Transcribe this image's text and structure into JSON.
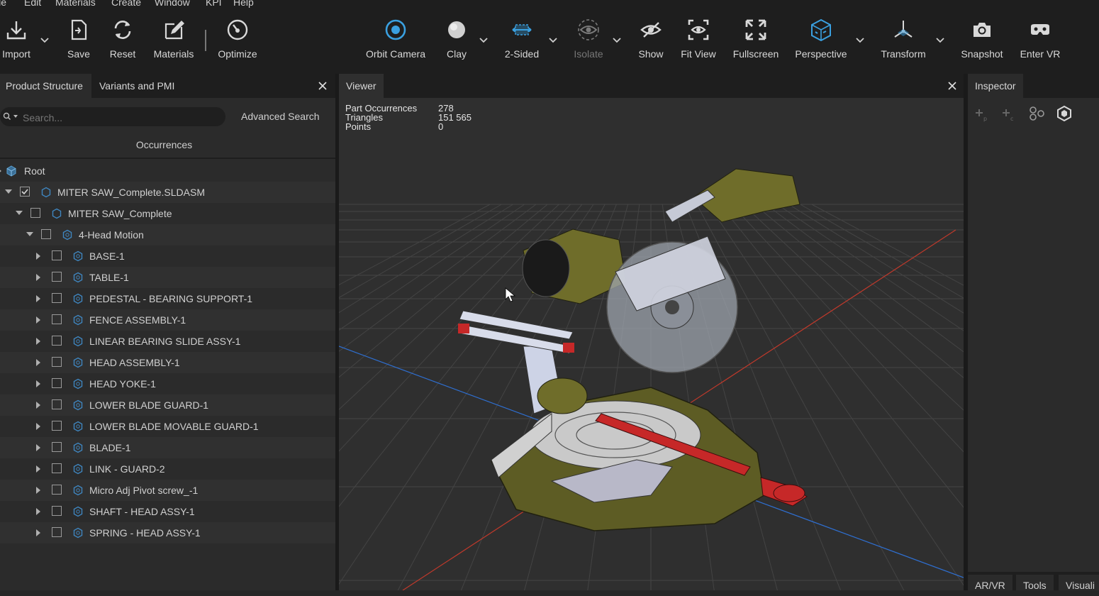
{
  "menu": [
    "ile",
    "Edit",
    "Materials",
    "Create",
    "Window",
    "KPI",
    "Help"
  ],
  "toolbar": {
    "left": [
      {
        "label": "Import",
        "icon": "import-icon"
      },
      {
        "label": "Save",
        "icon": "save-icon"
      },
      {
        "label": "Reset",
        "icon": "reset-icon"
      },
      {
        "label": "Materials",
        "icon": "materials-icon"
      },
      {
        "label": "Optimize",
        "icon": "optimize-icon"
      }
    ],
    "right": [
      {
        "label": "Orbit Camera",
        "icon": "orbit-camera-icon"
      },
      {
        "label": "Clay",
        "icon": "clay-icon"
      },
      {
        "label": "2-Sided",
        "icon": "two-sided-icon"
      },
      {
        "label": "Isolate",
        "icon": "isolate-icon"
      },
      {
        "label": "Show",
        "icon": "show-icon"
      },
      {
        "label": "Fit View",
        "icon": "fit-view-icon"
      },
      {
        "label": "Fullscreen",
        "icon": "fullscreen-icon"
      },
      {
        "label": "Perspective",
        "icon": "perspective-icon"
      },
      {
        "label": "Transform",
        "icon": "transform-icon"
      },
      {
        "label": "Snapshot",
        "icon": "snapshot-icon"
      },
      {
        "label": "Enter VR",
        "icon": "enter-vr-icon"
      }
    ]
  },
  "left_panel": {
    "tabs": [
      "Product Structure",
      "Variants and PMI"
    ],
    "search_placeholder": "Search...",
    "advanced_search": "Advanced Search",
    "occurrences_header": "Occurrences",
    "tree": [
      {
        "label": "Root",
        "level": 0,
        "expanded": false,
        "checkbox": "none",
        "icon": "root"
      },
      {
        "label": "MITER SAW_Complete.SLDASM",
        "level": 1,
        "expanded": true,
        "checkbox": "checked",
        "icon": "assembly"
      },
      {
        "label": "MITER SAW_Complete",
        "level": 2,
        "expanded": true,
        "checkbox": "empty",
        "icon": "assembly"
      },
      {
        "label": "4-Head Motion",
        "level": 3,
        "expanded": true,
        "checkbox": "empty",
        "icon": "part"
      },
      {
        "label": "BASE-1",
        "level": 4,
        "expanded": false,
        "checkbox": "empty",
        "icon": "part"
      },
      {
        "label": "TABLE-1",
        "level": 4,
        "expanded": false,
        "checkbox": "empty",
        "icon": "part"
      },
      {
        "label": "PEDESTAL - BEARING SUPPORT-1",
        "level": 4,
        "expanded": false,
        "checkbox": "empty",
        "icon": "part"
      },
      {
        "label": "FENCE ASSEMBLY-1",
        "level": 4,
        "expanded": false,
        "checkbox": "empty",
        "icon": "part"
      },
      {
        "label": "LINEAR BEARING SLIDE ASSY-1",
        "level": 4,
        "expanded": false,
        "checkbox": "empty",
        "icon": "part"
      },
      {
        "label": "HEAD ASSEMBLY-1",
        "level": 4,
        "expanded": false,
        "checkbox": "empty",
        "icon": "part"
      },
      {
        "label": "HEAD YOKE-1",
        "level": 4,
        "expanded": false,
        "checkbox": "empty",
        "icon": "part"
      },
      {
        "label": "LOWER BLADE GUARD-1",
        "level": 4,
        "expanded": false,
        "checkbox": "empty",
        "icon": "part"
      },
      {
        "label": "LOWER BLADE MOVABLE GUARD-1",
        "level": 4,
        "expanded": false,
        "checkbox": "empty",
        "icon": "part"
      },
      {
        "label": "BLADE-1",
        "level": 4,
        "expanded": false,
        "checkbox": "empty",
        "icon": "part"
      },
      {
        "label": "LINK - GUARD-2",
        "level": 4,
        "expanded": false,
        "checkbox": "empty",
        "icon": "part"
      },
      {
        "label": "Micro Adj Pivot screw_-1",
        "level": 4,
        "expanded": false,
        "checkbox": "empty",
        "icon": "part"
      },
      {
        "label": "SHAFT - HEAD ASSY-1",
        "level": 4,
        "expanded": false,
        "checkbox": "empty",
        "icon": "part"
      },
      {
        "label": "SPRING - HEAD ASSY-1",
        "level": 4,
        "expanded": false,
        "checkbox": "empty",
        "icon": "part"
      }
    ]
  },
  "viewer": {
    "tab": "Viewer",
    "stats": [
      {
        "key": "Part Occurrences",
        "value": "278"
      },
      {
        "key": "Triangles",
        "value": "151 565"
      },
      {
        "key": "Points",
        "value": "0"
      }
    ]
  },
  "inspector": {
    "tab": "Inspector",
    "icons": [
      "add-property-icon",
      "add-component-icon",
      "molecule-icon",
      "hexagon-icon"
    ],
    "bottom_tabs": [
      "AR/VR",
      "Tools",
      "Visuali"
    ]
  },
  "colors": {
    "accent": "#3aa0e0",
    "background": "#262626",
    "viewer_bg": "#2f2f2f",
    "model_olive": "#6f6d2a",
    "model_red": "#c62828",
    "axis_x": "#c0392b",
    "axis_z": "#2f6fd1"
  }
}
